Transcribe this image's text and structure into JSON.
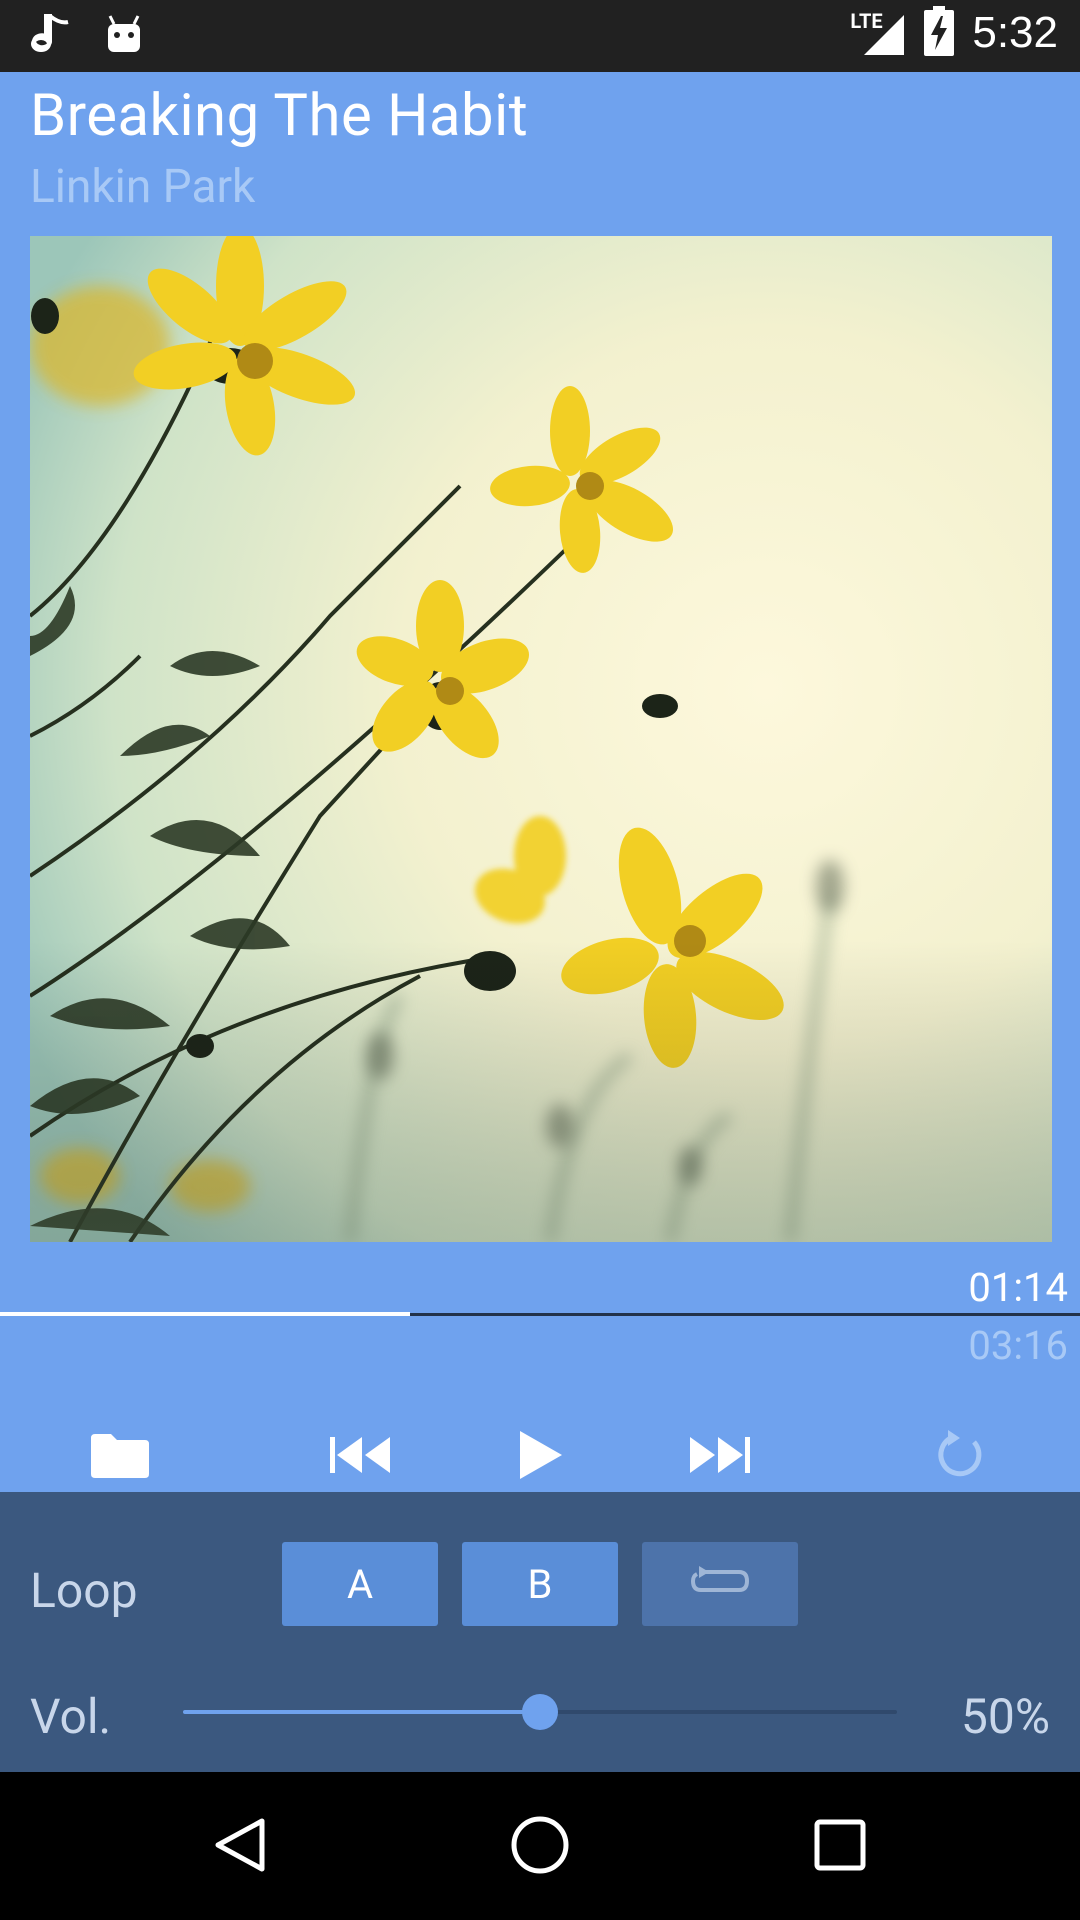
{
  "status_bar": {
    "time": "5:32",
    "network": "LTE",
    "icons": [
      "music-note-icon",
      "android-icon",
      "signal-icon",
      "battery-charging-icon"
    ]
  },
  "track": {
    "title": "Breaking The Habit",
    "artist": "Linkin Park",
    "elapsed": "01:14",
    "total": "03:16",
    "progress_fraction": 0.38
  },
  "controls": {
    "icons": [
      "folder-icon",
      "skip-previous-icon",
      "play-icon",
      "skip-next-icon",
      "repeat-icon"
    ]
  },
  "loop": {
    "label": "Loop",
    "a_label": "A",
    "b_label": "B"
  },
  "volume": {
    "label": "Vol.",
    "value_text": "50%",
    "fraction": 0.5
  },
  "colors": {
    "primary": "#6fa2ee",
    "panel": "#3b587f",
    "status_bar": "#212121"
  }
}
